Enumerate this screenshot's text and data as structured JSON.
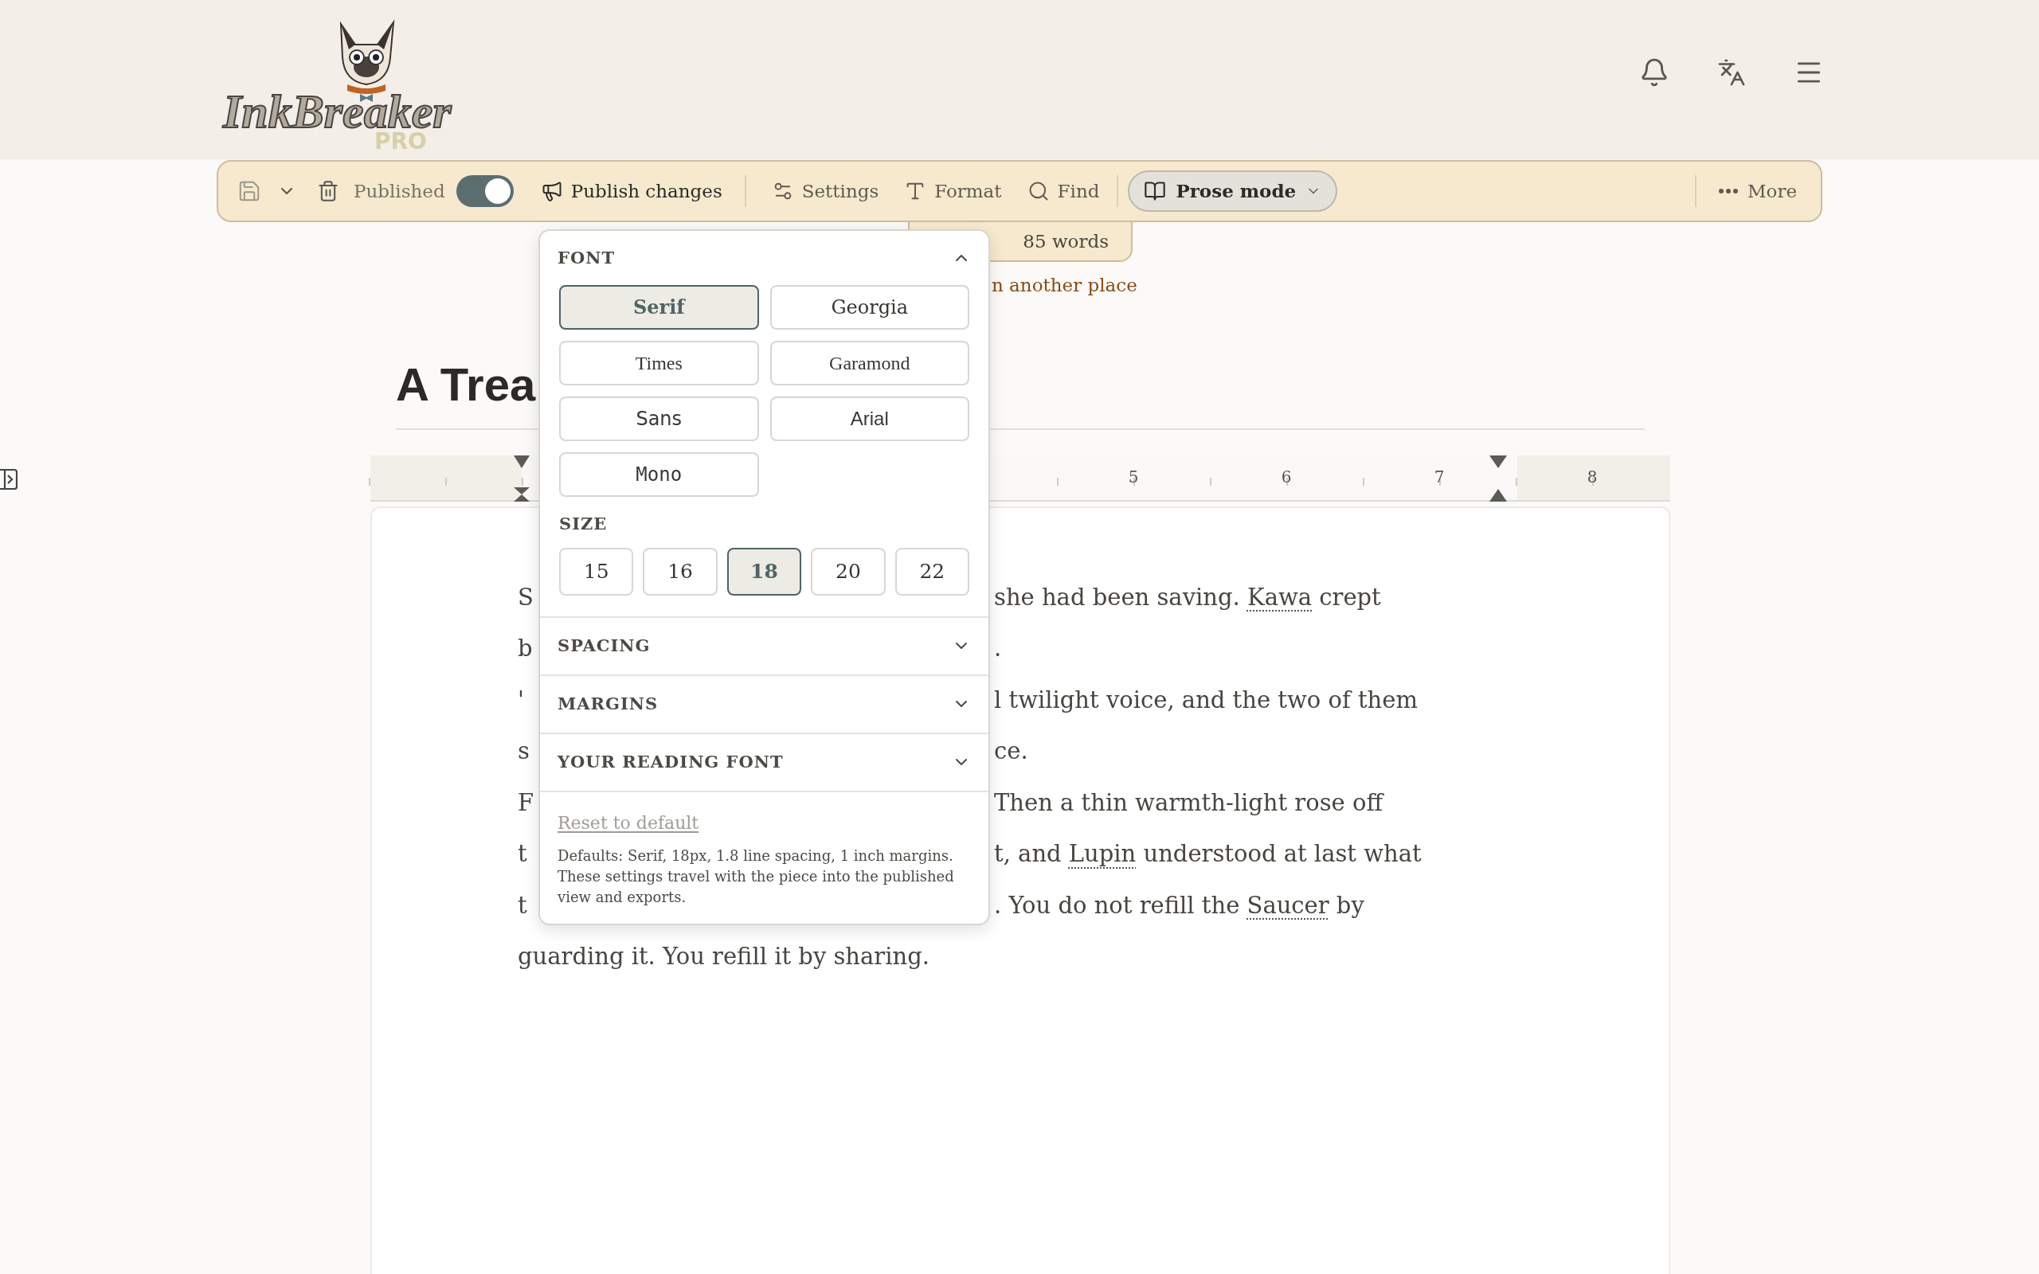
{
  "header": {
    "logo": {
      "name": "InkBreaker",
      "badge": "PRO"
    }
  },
  "toolbar": {
    "published": {
      "label": "Published",
      "on": true
    },
    "actions": [
      {
        "kind": "publish",
        "label": "Publish changes"
      },
      {
        "kind": "settings",
        "label": "Settings"
      },
      {
        "kind": "format",
        "label": "Format"
      },
      {
        "kind": "find",
        "label": "Find"
      }
    ],
    "mode": {
      "label": "Prose mode"
    },
    "more": {
      "label": "More"
    }
  },
  "word_count": "85 words",
  "status_note": "n another place",
  "title": "A Trea",
  "ruler": {
    "labels": [
      {
        "label": "5"
      },
      {
        "label": "6"
      },
      {
        "label": "7"
      },
      {
        "label": "8"
      }
    ]
  },
  "body": {
    "lines": [
      {
        "left": [
          {
            "kind": "plain",
            "text": "S"
          }
        ],
        "right": [
          {
            "kind": "plain",
            "text": "she had been saving. "
          },
          {
            "kind": "entity",
            "text": "Kawa"
          },
          {
            "kind": "plain",
            "text": " crept"
          }
        ]
      },
      {
        "left": [
          {
            "kind": "plain",
            "text": "b"
          }
        ],
        "right": [
          {
            "kind": "plain",
            "text": "."
          }
        ]
      },
      {
        "left": [
          {
            "kind": "plain",
            "text": "'"
          }
        ],
        "right": [
          {
            "kind": "plain",
            "text": "l twilight voice, and the two of them"
          }
        ]
      },
      {
        "left": [
          {
            "kind": "plain",
            "text": "s"
          }
        ],
        "right": [
          {
            "kind": "plain",
            "text": "ce."
          }
        ]
      },
      {
        "left": [
          {
            "kind": "plain",
            "text": "F"
          }
        ],
        "right": [
          {
            "kind": "plain",
            "text": "Then a thin warmth-light rose off"
          }
        ]
      },
      {
        "left": [
          {
            "kind": "plain",
            "text": "t"
          }
        ],
        "right": [
          {
            "kind": "plain",
            "text": "t, and "
          },
          {
            "kind": "entity",
            "text": "Lupin"
          },
          {
            "kind": "plain",
            "text": " understood at last what"
          }
        ]
      },
      {
        "left": [
          {
            "kind": "plain",
            "text": "t"
          }
        ],
        "right": [
          {
            "kind": "plain",
            "text": ". You do not refill the "
          },
          {
            "kind": "entity",
            "text": "Saucer"
          },
          {
            "kind": "plain",
            "text": " by"
          }
        ]
      },
      {
        "left": [
          {
            "kind": "plain",
            "text": "guarding it. You refill it by sharing."
          }
        ]
      }
    ]
  },
  "popover": {
    "sections": [
      {
        "title": "FONT",
        "expanded": true,
        "fonts": [
          {
            "label": "Serif",
            "kind": "serif",
            "selected": true
          },
          {
            "label": "Georgia",
            "kind": "georgia",
            "selected": false
          },
          {
            "label": "Times",
            "kind": "times",
            "selected": false
          },
          {
            "label": "Garamond",
            "kind": "garamond",
            "selected": false
          },
          {
            "label": "Sans",
            "kind": "sans",
            "selected": false
          },
          {
            "label": "Arial",
            "kind": "arial",
            "selected": false
          },
          {
            "label": "Mono",
            "kind": "mono",
            "selected": false
          }
        ],
        "size_label": "SIZE",
        "sizes": [
          {
            "label": "15",
            "selected": false
          },
          {
            "label": "16",
            "selected": false
          },
          {
            "label": "18",
            "selected": true
          },
          {
            "label": "20",
            "selected": false
          },
          {
            "label": "22",
            "selected": false
          }
        ]
      },
      {
        "title": "SPACING",
        "expanded": false
      },
      {
        "title": "MARGINS",
        "expanded": false
      },
      {
        "title": "YOUR READING FONT",
        "expanded": false
      }
    ],
    "reset": "Reset to default",
    "note": "Defaults: Serif, 18px, 1.8 line spacing, 1 inch margins. These settings travel with the piece into the published view and exports."
  }
}
